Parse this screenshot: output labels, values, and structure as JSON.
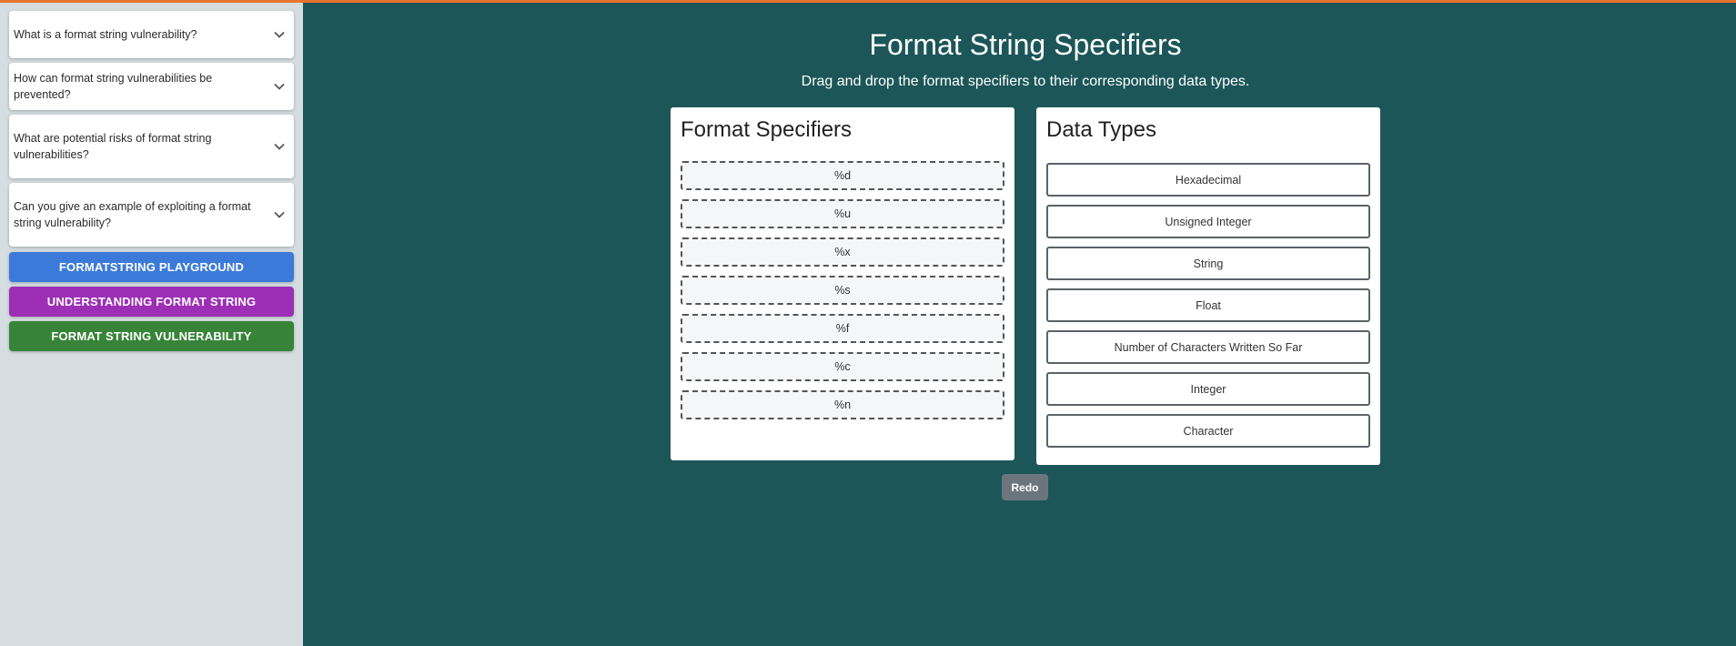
{
  "sidebar": {
    "faq": [
      {
        "question": "What is a format string vulnerability?"
      },
      {
        "question": "How can format string vulnerabilities be prevented?"
      },
      {
        "question": "What are potential risks of format string vulnerabilities?"
      },
      {
        "question": "Can you give an example of exploiting a format string vulnerability?"
      }
    ],
    "buttons": [
      {
        "label": "FORMATSTRING PLAYGROUND",
        "color": "#3b7ad9"
      },
      {
        "label": "UNDERSTANDING FORMAT STRING",
        "color": "#9c2fb5"
      },
      {
        "label": "FORMAT STRING VULNERABILITY",
        "color": "#378439"
      }
    ]
  },
  "main": {
    "title": "Format String Specifiers",
    "subtitle": "Drag and drop the format specifiers to their corresponding data types.",
    "specifiers_panel": {
      "heading": "Format Specifiers",
      "items": [
        "%d",
        "%u",
        "%x",
        "%s",
        "%f",
        "%c",
        "%n"
      ]
    },
    "types_panel": {
      "heading": "Data Types",
      "items": [
        "Hexadecimal",
        "Unsigned Integer",
        "String",
        "Float",
        "Number of Characters Written So Far",
        "Integer",
        "Character"
      ]
    },
    "redo_label": "Redo"
  },
  "colors": {
    "background": "#1c5659",
    "sidebar": "#d5dde0",
    "top_accent": "#e8742f",
    "redo_button": "#6c757d"
  },
  "icons": {
    "faq_toggle": "chevron-down-icon"
  }
}
